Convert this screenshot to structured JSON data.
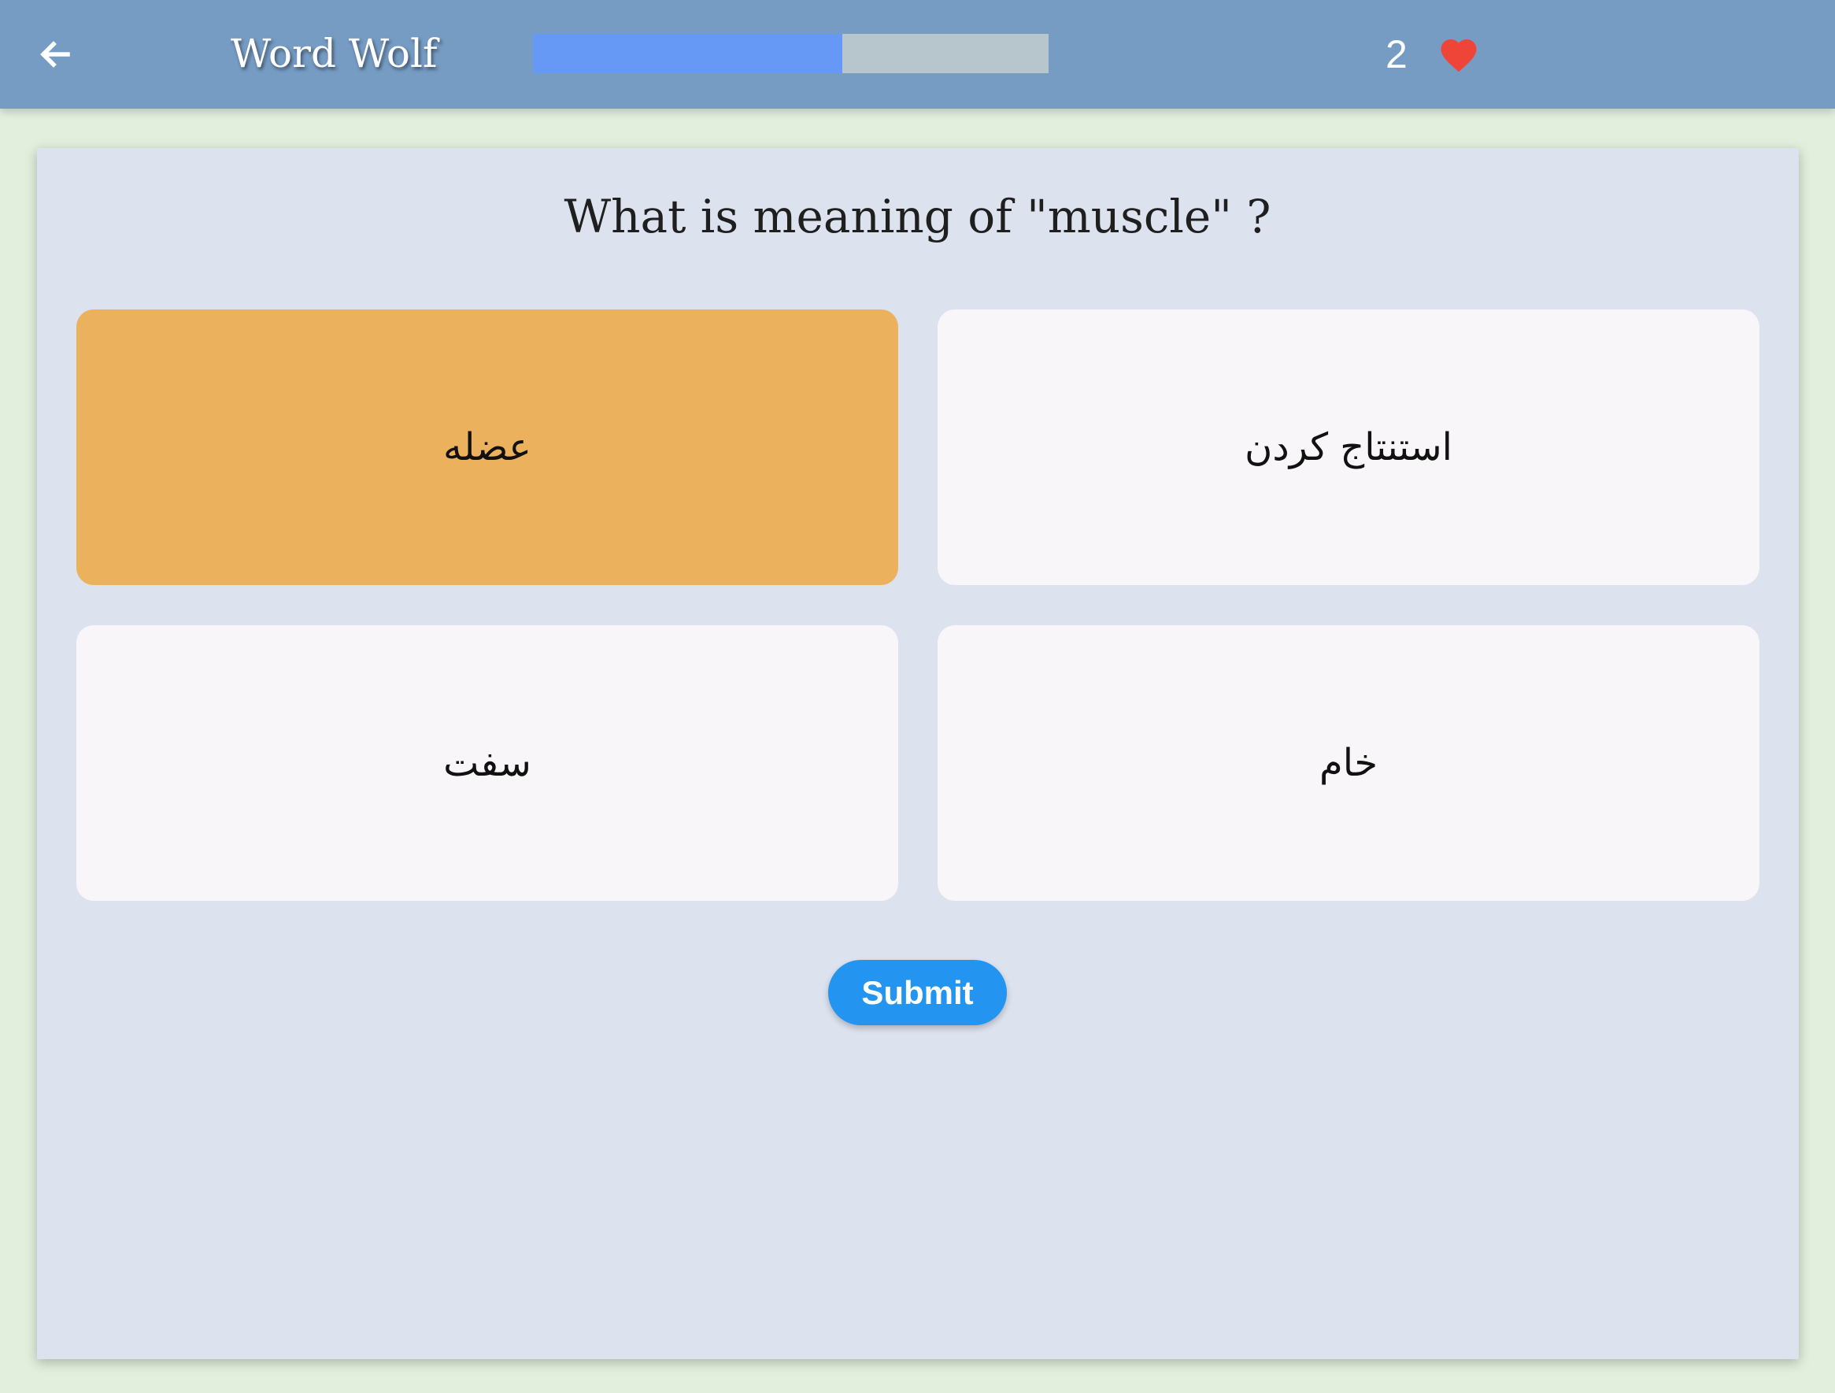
{
  "header": {
    "back_icon": "arrow-left-icon",
    "title": "Word Wolf",
    "progress": 0.6,
    "lives": "2",
    "lives_icon": "heart-icon",
    "colors": {
      "bar": "#769cc4",
      "progress_fill": "#6699f5",
      "progress_track": "#b7c6cc",
      "heart": "#ef4438"
    }
  },
  "quiz": {
    "question": "What is meaning of \"muscle\" ?",
    "options": [
      {
        "label": "عضله",
        "selected": true
      },
      {
        "label": "استنتاج کردن",
        "selected": false
      },
      {
        "label": "سفت",
        "selected": false
      },
      {
        "label": "خام",
        "selected": false
      }
    ],
    "submit_label": "Submit",
    "colors": {
      "selected": "#ecb15c",
      "option": "#f8f6f8",
      "submit": "#2395f0"
    }
  }
}
